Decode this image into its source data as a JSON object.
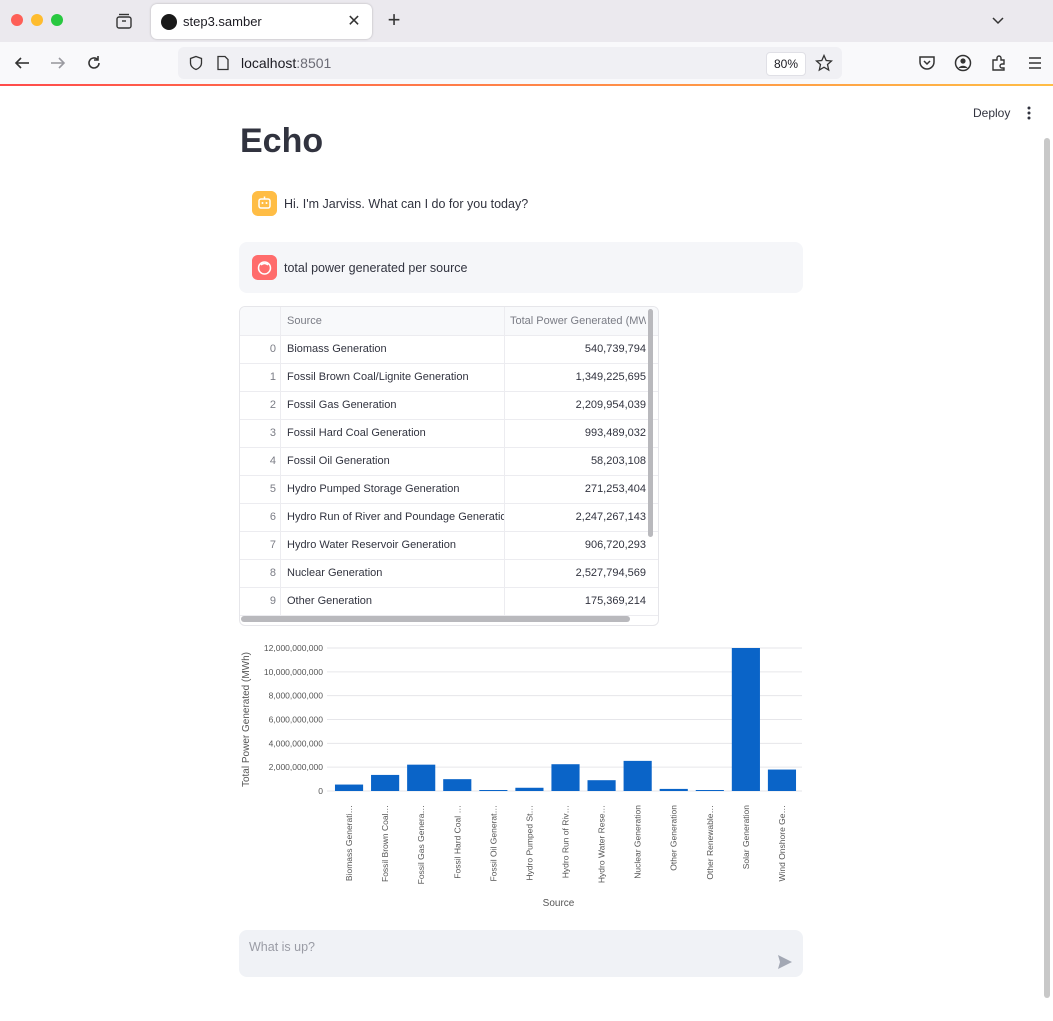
{
  "browser": {
    "tab_title": "step3.samber",
    "tab_close": "✕",
    "new_tab": "+",
    "url_host": "localhost",
    "url_port": ":8501",
    "zoom": "80%"
  },
  "app": {
    "deploy_label": "Deploy",
    "title": "Echo",
    "messages": [
      {
        "role": "assistant",
        "text": "Hi. I'm Jarviss. What can I do for you today?"
      },
      {
        "role": "user",
        "text": "total power generated per source"
      }
    ],
    "chat_input_placeholder": "What is up?"
  },
  "table": {
    "columns": [
      "",
      "Source",
      "Total Power Generated (MWh)"
    ],
    "rows": [
      {
        "idx": "0",
        "source": "Biomass Generation",
        "value": "540,739,794"
      },
      {
        "idx": "1",
        "source": "Fossil Brown Coal/Lignite Generation",
        "value": "1,349,225,695"
      },
      {
        "idx": "2",
        "source": "Fossil Gas Generation",
        "value": "2,209,954,039"
      },
      {
        "idx": "3",
        "source": "Fossil Hard Coal Generation",
        "value": "993,489,032"
      },
      {
        "idx": "4",
        "source": "Fossil Oil Generation",
        "value": "58,203,108"
      },
      {
        "idx": "5",
        "source": "Hydro Pumped Storage Generation",
        "value": "271,253,404"
      },
      {
        "idx": "6",
        "source": "Hydro Run of River and Poundage Generation",
        "value": "2,247,267,143"
      },
      {
        "idx": "7",
        "source": "Hydro Water Reservoir Generation",
        "value": "906,720,293"
      },
      {
        "idx": "8",
        "source": "Nuclear Generation",
        "value": "2,527,794,569"
      },
      {
        "idx": "9",
        "source": "Other Generation",
        "value": "175,369,214"
      }
    ]
  },
  "chart_data": {
    "type": "bar",
    "xlabel": "Source",
    "ylabel": "Total Power Generated (MWh)",
    "ylim": [
      0,
      12000000000
    ],
    "yticks": [
      "0",
      "2,000,000,000",
      "4,000,000,000",
      "6,000,000,000",
      "8,000,000,000",
      "10,000,000,000",
      "12,000,000,000"
    ],
    "categories": [
      "Biomass Generati…",
      "Fossil Brown Coal…",
      "Fossil Gas Genera…",
      "Fossil Hard Coal …",
      "Fossil Oil Generat…",
      "Hydro Pumped St…",
      "Hydro Run of Riv…",
      "Hydro Water Rese…",
      "Nuclear Generation",
      "Other Generation",
      "Other Renewable…",
      "Solar Generation",
      "Wind Onshore Ge…"
    ],
    "values": [
      540739794,
      1349225695,
      2209954039,
      993489032,
      58203108,
      271253404,
      2247267143,
      906720293,
      2527794569,
      175369214,
      5000000,
      12000000000,
      1800000000
    ],
    "color": "#0a64c8",
    "grid": true
  }
}
